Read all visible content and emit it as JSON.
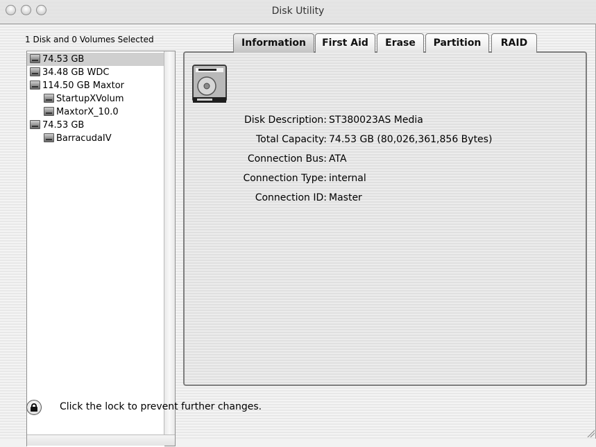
{
  "window": {
    "title": "Disk Utility"
  },
  "selection_label": "1 Disk and 0 Volumes Selected",
  "sidebar": {
    "items": [
      {
        "label": "74.53 GB",
        "type": "disk",
        "selected": true
      },
      {
        "label": "34.48 GB WDC",
        "type": "disk"
      },
      {
        "label": "114.50 GB Maxtor",
        "type": "disk"
      },
      {
        "label": "StartupXVolum",
        "type": "volume"
      },
      {
        "label": "MaxtorX_10.0",
        "type": "volume"
      },
      {
        "label": "74.53 GB",
        "type": "disk"
      },
      {
        "label": "BarracudaIV",
        "type": "volume"
      }
    ]
  },
  "tabs": [
    {
      "label": "Information",
      "active": true
    },
    {
      "label": "First Aid"
    },
    {
      "label": "Erase"
    },
    {
      "label": "Partition"
    },
    {
      "label": "RAID"
    }
  ],
  "info": {
    "disk_description_label": "Disk Description:",
    "disk_description": "ST380023AS Media",
    "total_capacity_label": "Total Capacity:",
    "total_capacity": "74.53 GB (80,026,361,856 Bytes)",
    "connection_bus_label": "Connection Bus:",
    "connection_bus": "ATA",
    "connection_type_label": "Connection Type:",
    "connection_type": "internal",
    "connection_id_label": "Connection ID:",
    "connection_id": "Master"
  },
  "lock": {
    "icon": "lock-icon",
    "text": "Click the lock to prevent further changes."
  },
  "icons": {
    "disk": "hard-disk-icon",
    "volume": "volume-icon"
  }
}
